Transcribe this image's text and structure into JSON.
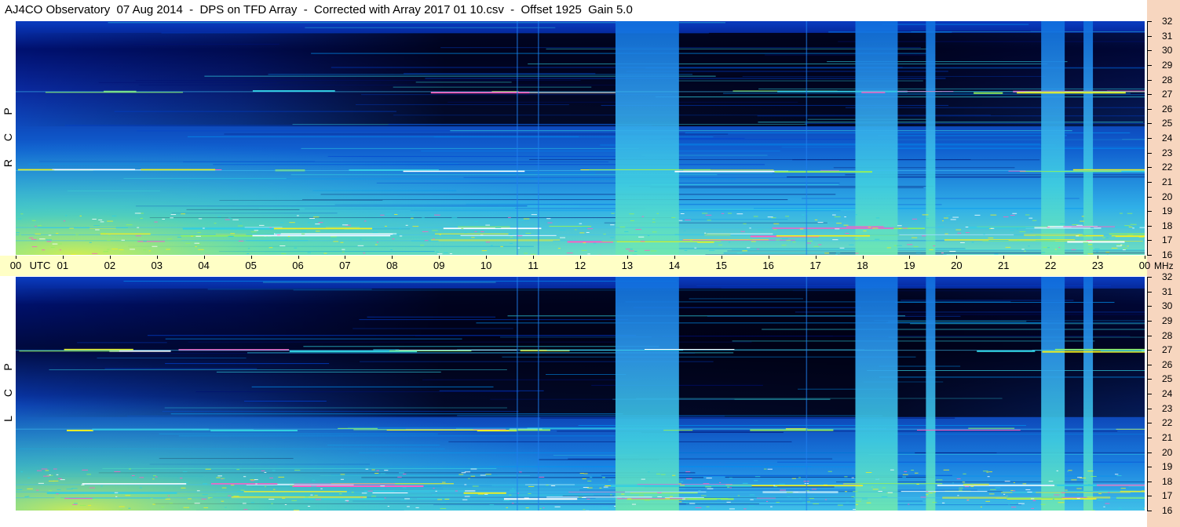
{
  "title": "AJ4CO Observatory  07 Aug 2014  -  DPS on TFD Array  -  Corrected with Array 2017 01 10.csv  -  Offset 1925  Gain 5.0",
  "colors": {
    "background": "#ffffff",
    "time_strip": "#ffffc6",
    "freq_strip": "#f7d6bf"
  },
  "chart_data": [
    {
      "type": "heatmap",
      "name": "RCP",
      "polarization_label": [
        "R",
        "C",
        "P"
      ],
      "x_unit": "UTC",
      "x_ticks": [
        "00",
        "01",
        "02",
        "03",
        "04",
        "05",
        "06",
        "07",
        "08",
        "09",
        "10",
        "11",
        "12",
        "13",
        "14",
        "15",
        "16",
        "17",
        "18",
        "19",
        "20",
        "21",
        "22",
        "23",
        "00"
      ],
      "y_unit": "MHz",
      "y_ticks": [
        16,
        17,
        18,
        19,
        20,
        21,
        22,
        23,
        24,
        25,
        26,
        27,
        28,
        29,
        30,
        31,
        32
      ],
      "xlim": [
        0,
        24
      ],
      "ylim": [
        16,
        32
      ],
      "colormap": [
        "#000016",
        "#001070",
        "#0040d0",
        "#0090f0",
        "#30d0e0",
        "#90f060",
        "#f0f020",
        "#ff60c0",
        "#ffffff"
      ],
      "broadband_bands_utc": [
        [
          12.75,
          14.1
        ],
        [
          17.85,
          18.75
        ],
        [
          19.35,
          19.55
        ],
        [
          21.8,
          22.3
        ],
        [
          22.7,
          22.9
        ]
      ],
      "interference_lines_mhz": [
        27.2,
        21.8,
        17.9,
        17.4,
        17.0
      ]
    },
    {
      "type": "heatmap",
      "name": "LCP",
      "polarization_label": [
        "L",
        "C",
        "P"
      ],
      "x_unit": "UTC",
      "x_ticks": [
        "00",
        "01",
        "02",
        "03",
        "04",
        "05",
        "06",
        "07",
        "08",
        "09",
        "10",
        "11",
        "12",
        "13",
        "14",
        "15",
        "16",
        "17",
        "18",
        "19",
        "20",
        "21",
        "22",
        "23",
        "00"
      ],
      "y_unit": "MHz",
      "y_ticks": [
        16,
        17,
        18,
        19,
        20,
        21,
        22,
        23,
        24,
        25,
        26,
        27,
        28,
        29,
        30,
        31,
        32
      ],
      "xlim": [
        0,
        24
      ],
      "ylim": [
        16,
        32
      ],
      "colormap": [
        "#000016",
        "#001070",
        "#0040d0",
        "#0090f0",
        "#30d0e0",
        "#90f060",
        "#f0f020",
        "#ff60c0",
        "#ffffff"
      ],
      "broadband_bands_utc": [
        [
          12.75,
          14.1
        ],
        [
          17.85,
          18.75
        ],
        [
          19.35,
          19.55
        ],
        [
          21.8,
          22.3
        ],
        [
          22.7,
          22.9
        ]
      ],
      "interference_lines_mhz": [
        27.0,
        21.6,
        17.8,
        17.3,
        16.9
      ]
    }
  ],
  "time_axis": {
    "hours": [
      "00",
      "01",
      "02",
      "03",
      "04",
      "05",
      "06",
      "07",
      "08",
      "09",
      "10",
      "11",
      "12",
      "13",
      "14",
      "15",
      "16",
      "17",
      "18",
      "19",
      "20",
      "21",
      "22",
      "23",
      "00"
    ],
    "utc_label": "UTC",
    "mhz_label": "MHz"
  }
}
